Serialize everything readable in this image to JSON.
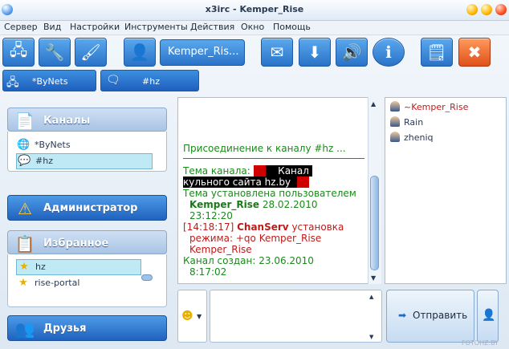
{
  "window": {
    "title": "x3irc - Kemper_Rise"
  },
  "menu": [
    "Сервер",
    "Вид",
    "Настройки",
    "Инструменты",
    "Действия",
    "Окно",
    "Помощь"
  ],
  "toolbar": {
    "nick": "Kemper_Ris..."
  },
  "tabs": [
    "*ByNets",
    "#hz"
  ],
  "sections": {
    "channels": {
      "title": "Каналы",
      "items": [
        "*ByNets",
        "#hz"
      ]
    },
    "admin": {
      "title": "Администратор"
    },
    "favorites": {
      "title": "Избранное",
      "items": [
        "hz",
        "rise-portal"
      ]
    },
    "friends": {
      "title": "Друзья"
    }
  },
  "chat": {
    "join": "Присоединение к каналу #hz ...",
    "topic_label": "Тема канала:",
    "topic_word": "Канал",
    "topic_line2": "кульного сайта hz.by",
    "topic_set_by": "Тема установлена пользователем",
    "topic_user": "Kemper_Rise",
    "topic_date": "28.02.2010",
    "topic_time": "23:12:20",
    "mode_time": "[14:18:17]",
    "mode_user": "ChanServ",
    "mode_text1": "установка",
    "mode_text2": "режима: +qo Kemper_Rise",
    "mode_text3": "Kemper_Rise",
    "created_label": "Канал создан: 23.06.2010",
    "created_time": "8:17:02"
  },
  "nicks": [
    "~Kemper_Rise",
    "Rain",
    "zheniq"
  ],
  "send": {
    "label": "Отправить"
  },
  "watermark": "FOTOHZ.BY"
}
